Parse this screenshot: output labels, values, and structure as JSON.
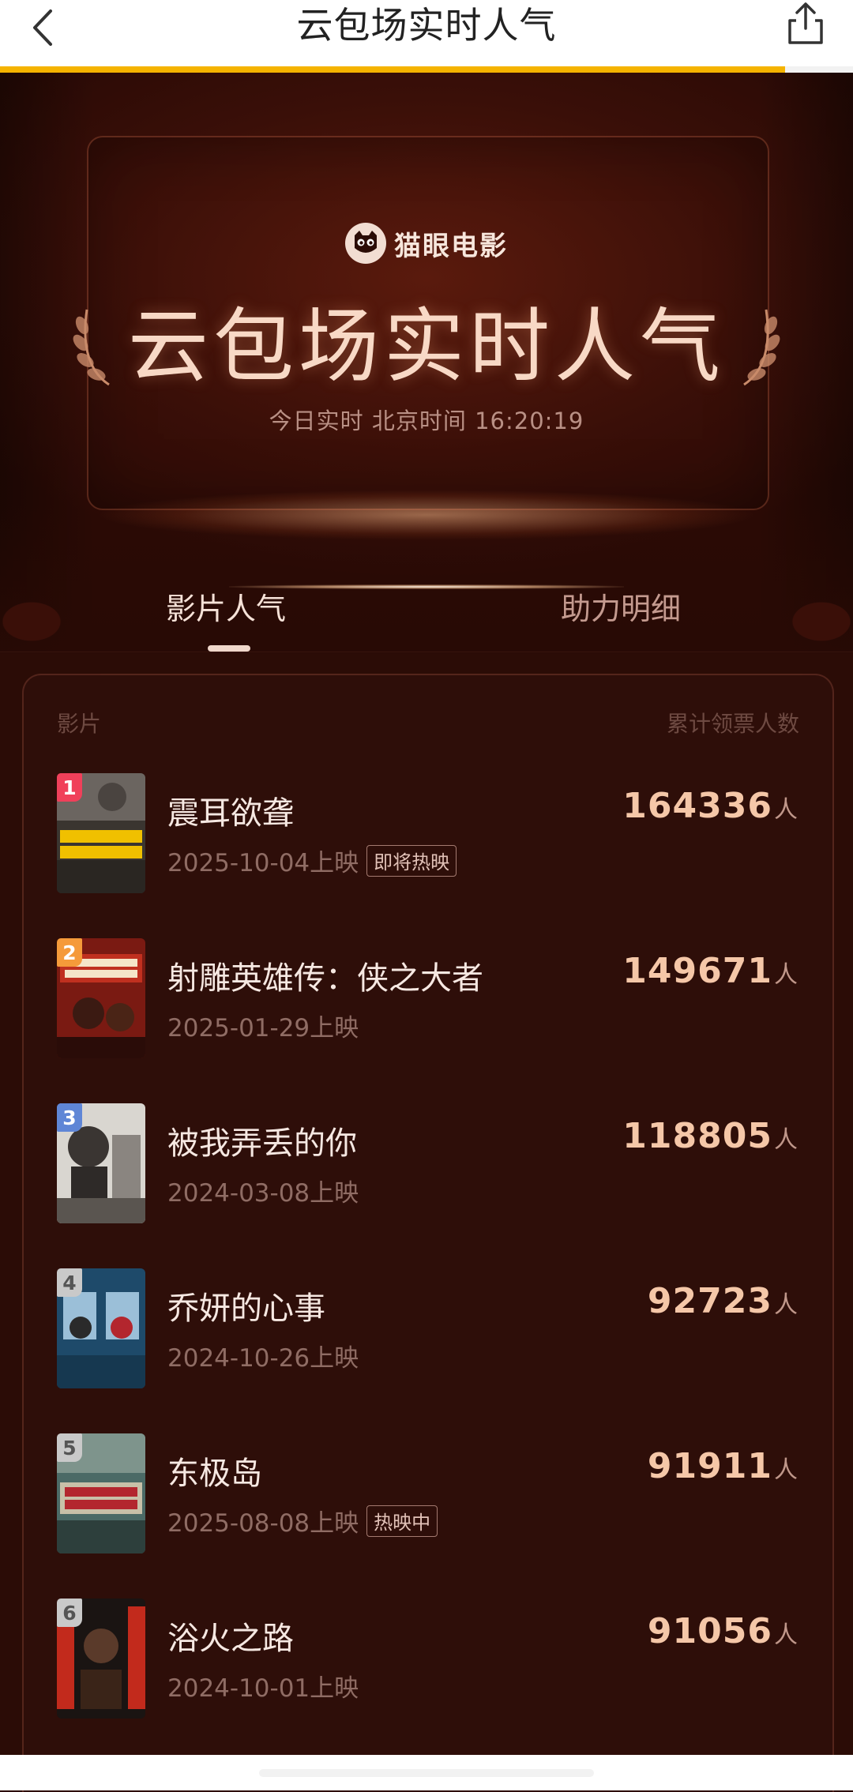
{
  "nav": {
    "title": "云包场实时人气",
    "progress_fraction": 0.92
  },
  "hero": {
    "brand": "猫眼电影",
    "title": "云包场实时人气",
    "time_text": "今日实时 北京时间 16:20:19"
  },
  "tabs": [
    {
      "label": "影片人气",
      "active": true
    },
    {
      "label": "助力明细",
      "active": false
    }
  ],
  "list": {
    "col_film": "影片",
    "col_count": "累计领票人数",
    "unit": "人",
    "items": [
      {
        "rank": "1",
        "name": "震耳欲聋",
        "date": "2025-10-04上映",
        "badge": "即将热映",
        "count": "164336"
      },
      {
        "rank": "2",
        "name": "射雕英雄传：侠之大者",
        "date": "2025-01-29上映",
        "badge": "",
        "count": "149671"
      },
      {
        "rank": "3",
        "name": "被我弄丢的你",
        "date": "2024-03-08上映",
        "badge": "",
        "count": "118805"
      },
      {
        "rank": "4",
        "name": "乔妍的心事",
        "date": "2024-10-26上映",
        "badge": "",
        "count": "92723"
      },
      {
        "rank": "5",
        "name": "东极岛",
        "date": "2025-08-08上映",
        "badge": "热映中",
        "count": "91911"
      },
      {
        "rank": "6",
        "name": "浴火之路",
        "date": "2024-10-01上映",
        "badge": "",
        "count": "91056"
      }
    ]
  },
  "colors": {
    "rank1": "#f0405a",
    "rank2": "#f59a3a",
    "rank3": "#5f86d6",
    "rank_other": "#c9c9c9",
    "accent_progress": "#f5b300"
  }
}
